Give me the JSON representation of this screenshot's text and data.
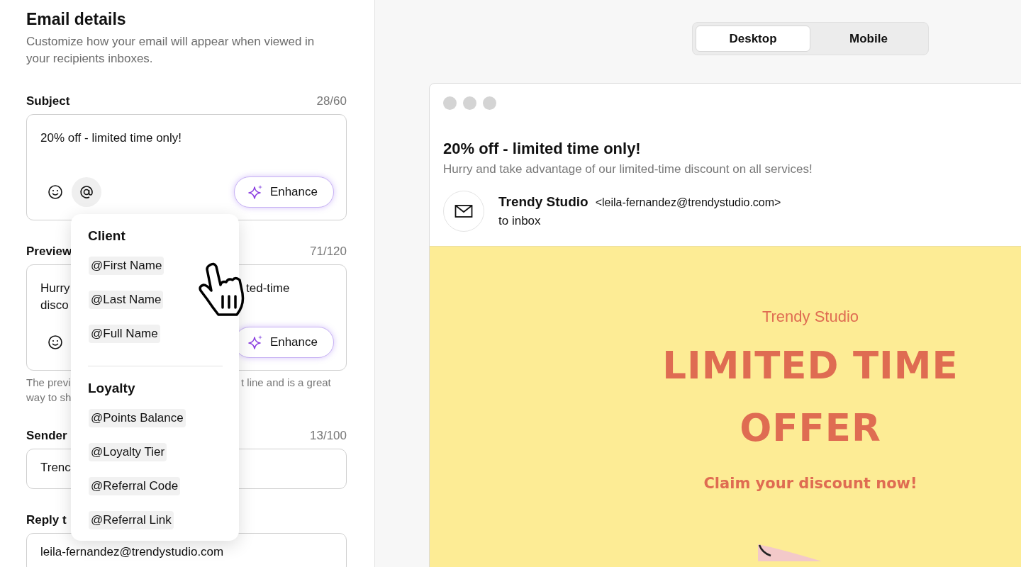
{
  "panel": {
    "title": "Email details",
    "description": "Customize how your email will appear when viewed in your recipients inboxes."
  },
  "fields": [
    {
      "kind": "textarea",
      "label": "Subject",
      "counter": "28/60",
      "value_left": [
        "20% off - limited time only!"
      ],
      "tools": [
        {
          "kind": "emoji",
          "selected": false
        },
        {
          "kind": "mention",
          "selected": true
        }
      ],
      "enhance": "Enhance"
    },
    {
      "kind": "textarea",
      "label": "Preview",
      "counter": "71/120",
      "value_left": [
        "Hurry",
        "disco"
      ],
      "value_right": [
        "ted-time"
      ],
      "tools": [
        {
          "kind": "emoji",
          "selected": false
        }
      ],
      "enhance": "Enhance",
      "hint_left": [
        "The previ",
        "way to sh"
      ],
      "hint_right": [
        "t line and is a great"
      ]
    },
    {
      "kind": "input",
      "label": "Sender",
      "counter": "13/100",
      "value_left": [
        "Trenc"
      ]
    },
    {
      "kind": "input",
      "label": "Reply t",
      "value_left": [
        "leila-fernandez@trendystudio.com"
      ]
    }
  ],
  "mention_menu": {
    "sections": [
      {
        "title": "Client",
        "items": [
          "@First Name",
          "@Last Name",
          "@Full Name"
        ]
      },
      {
        "title": "Loyalty",
        "items": [
          "@Points Balance",
          "@Loyalty Tier",
          "@Referral Code",
          "@Referral Link"
        ]
      }
    ]
  },
  "view_toggle": [
    {
      "label": "Desktop",
      "selected": true
    },
    {
      "label": "Mobile",
      "selected": false
    }
  ],
  "email_preview": {
    "subject": "20% off - limited time only!",
    "preview_text": "Hurry and take advantage of our limited-time discount on all services!",
    "sender_name": "Trendy Studio",
    "sender_email": "<leila-fernandez@trendystudio.com>",
    "recipient": "to inbox",
    "banner": {
      "brand": "Trendy Studio",
      "headline": "LIMITED TIME OFFER",
      "cta": "Claim your discount now!"
    }
  }
}
